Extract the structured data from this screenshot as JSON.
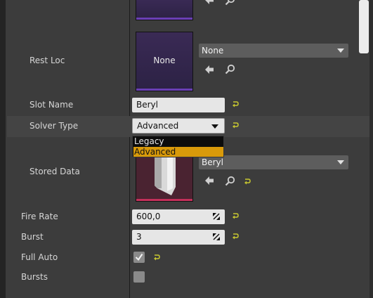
{
  "properties": {
    "rest_loc": {
      "label": "Rest Loc",
      "thumbnail_text": "None",
      "asset_value": "None"
    },
    "slot_name": {
      "label": "Slot Name",
      "value": "Beryl"
    },
    "solver_type": {
      "label": "Solver Type",
      "value": "Advanced",
      "options": [
        "Legacy",
        "Advanced"
      ],
      "highlighted_option": "Advanced"
    },
    "stored_data": {
      "label": "Stored Data",
      "asset_value": "Beryl"
    },
    "fire_rate": {
      "label": "Fire Rate",
      "value": "600,0"
    },
    "burst": {
      "label": "Burst",
      "value": "3"
    },
    "full_auto": {
      "label": "Full Auto",
      "checked": true
    },
    "bursts": {
      "label": "Bursts",
      "checked": false
    }
  },
  "colors": {
    "panel_bg": "#3c3c3c",
    "highlight_option": "#d99a0a",
    "reset_arrow": "#c8c830",
    "purple_accent": "#6a3fb5",
    "red_accent": "#c4305a"
  },
  "icons": [
    "back-arrow-icon",
    "browse-magnifier-icon",
    "reset-to-default-icon",
    "spin-drag-icon",
    "checkmark-icon",
    "dropdown-chevron-icon"
  ]
}
